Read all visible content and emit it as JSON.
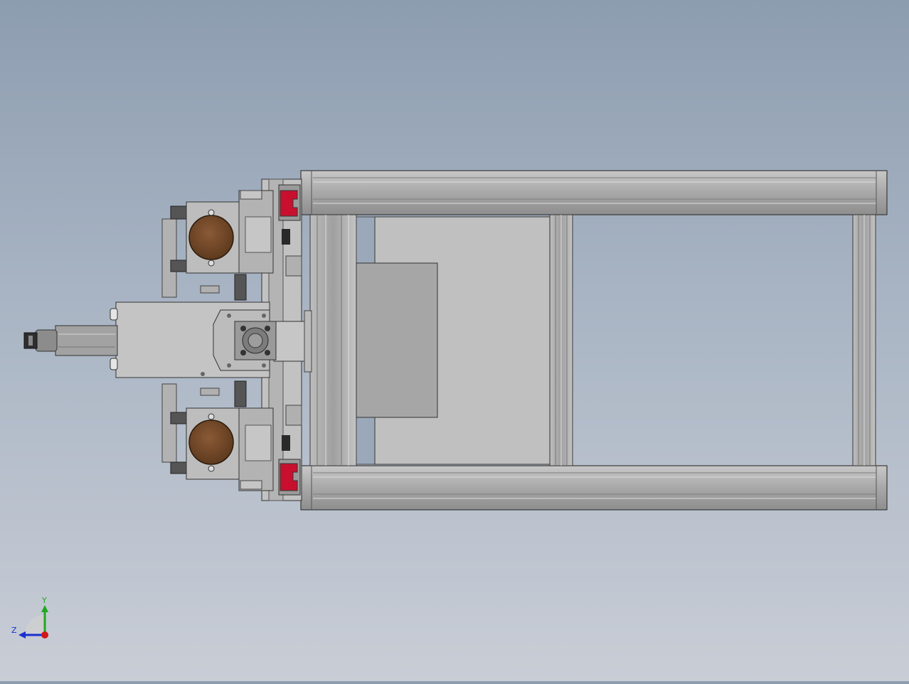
{
  "viewport": {
    "background_top": "#8d9db0",
    "background_bottom": "#c9cdd6"
  },
  "model": {
    "frame_color": "#a9a9a9",
    "plate_color": "#c0c0c0",
    "roller_color": "#7a4a2a",
    "bracket_color": "#c8102e"
  },
  "triad": {
    "x_label": "",
    "y_label": "Y",
    "z_label": "Z",
    "x_color": "#d01818",
    "y_color": "#1fa81f",
    "z_color": "#1a2fd0"
  }
}
